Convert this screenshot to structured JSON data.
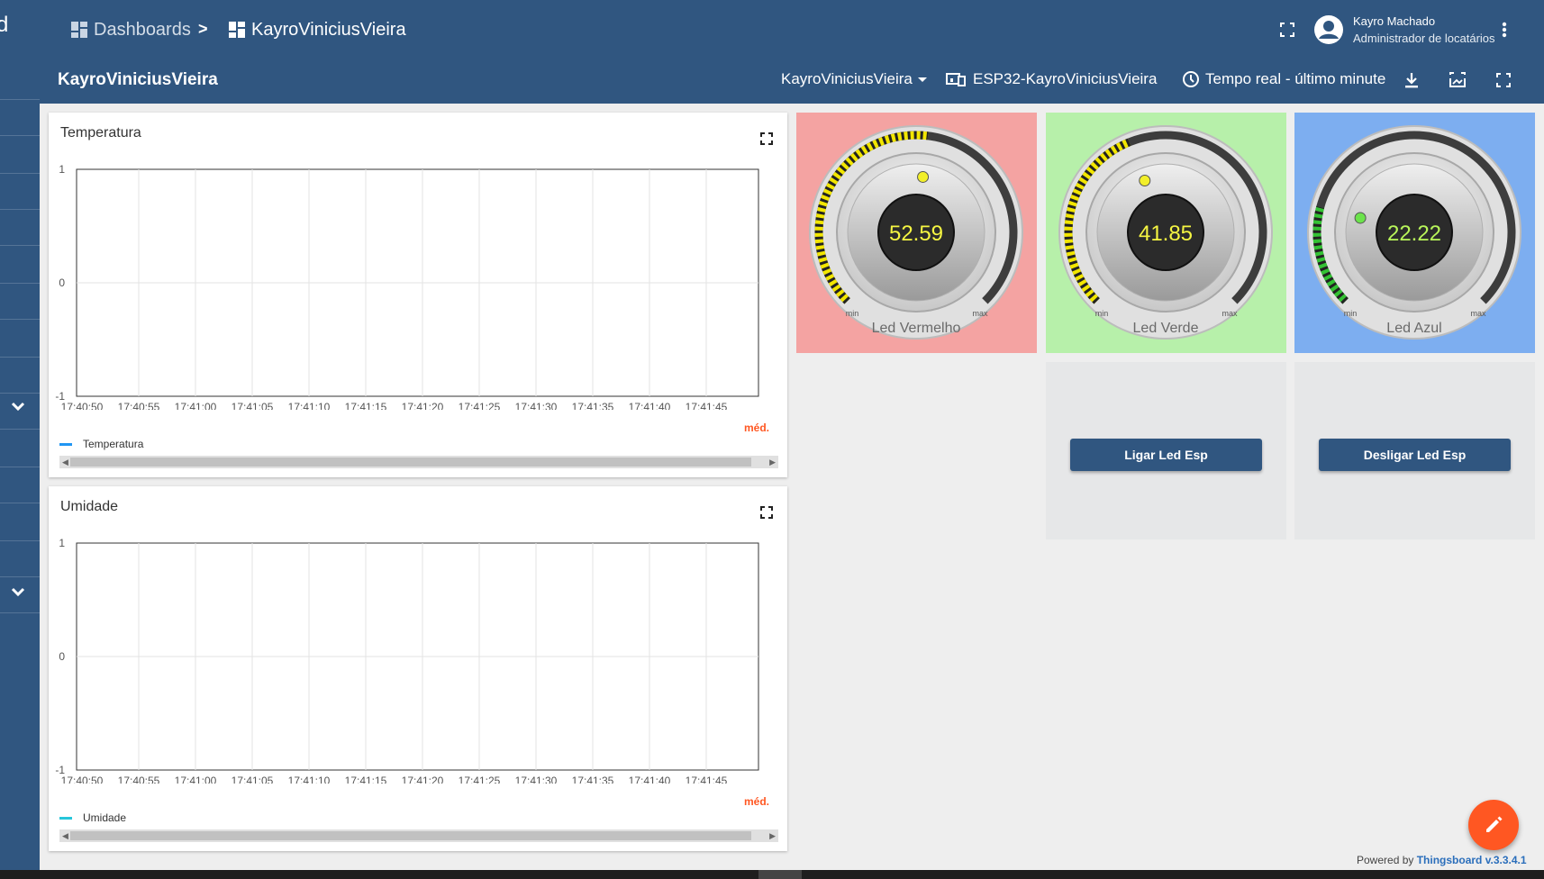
{
  "breadcrumb": {
    "root": "Dashboards",
    "separator": ">",
    "current": "KayroViniciusVieira"
  },
  "user": {
    "name": "Kayro Machado",
    "role": "Administrador de locatários"
  },
  "toolbar": {
    "title": "KayroViniciusVieira",
    "state_select": "KayroViniciusVieira",
    "entity": "ESP32-KayroViniciusVieira",
    "timewindow": "Tempo real - último minute"
  },
  "sidebar": {
    "partial_letter": "d"
  },
  "colors": {
    "primary": "#305680",
    "accent": "#ff5722",
    "knob_red_bg": "#f4a3a2",
    "knob_green_bg": "#b7f0aa",
    "knob_blue_bg": "#7daef0",
    "value_text": "#f5f542"
  },
  "widgets": {
    "temperatura": {
      "title": "Temperatura",
      "legend": "Temperatura",
      "legend_color": "#2196f3",
      "avg_label": "méd."
    },
    "umidade": {
      "title": "Umidade",
      "legend": "Umidade",
      "legend_color": "#26c6da",
      "avg_label": "méd."
    },
    "knobs": [
      {
        "label": "Led Vermelho",
        "value": "52.59",
        "fraction": 0.5259,
        "min_label": "min",
        "max_label": "max",
        "bg": "#f4a3a2",
        "dot": "#f2ef2a"
      },
      {
        "label": "Led Verde",
        "value": "41.85",
        "fraction": 0.4185,
        "min_label": "min",
        "max_label": "max",
        "bg": "#b7f0aa",
        "dot": "#f2ef2a"
      },
      {
        "label": "Led Azul",
        "value": "22.22",
        "fraction": 0.2222,
        "min_label": "min",
        "max_label": "max",
        "bg": "#7daef0",
        "dot": "#6be34b"
      }
    ],
    "buttons": {
      "on": "Ligar Led Esp",
      "off": "Desligar Led Esp"
    }
  },
  "chart_data": [
    {
      "type": "line",
      "title": "Temperatura",
      "series": [
        {
          "name": "Temperatura",
          "values": []
        }
      ],
      "x": [
        "17:40:50",
        "17:40:55",
        "17:41:00",
        "17:41:05",
        "17:41:10",
        "17:41:15",
        "17:41:20",
        "17:41:25",
        "17:41:30",
        "17:41:35",
        "17:41:40",
        "17:41:45"
      ],
      "yticks": [
        "1",
        "0",
        "-1"
      ],
      "ylim": [
        -1,
        1
      ],
      "grid": true,
      "legend": "bottom-left"
    },
    {
      "type": "line",
      "title": "Umidade",
      "series": [
        {
          "name": "Umidade",
          "values": []
        }
      ],
      "x": [
        "17:40:50",
        "17:40:55",
        "17:41:00",
        "17:41:05",
        "17:41:10",
        "17:41:15",
        "17:41:20",
        "17:41:25",
        "17:41:30",
        "17:41:35",
        "17:41:40",
        "17:41:45"
      ],
      "yticks": [
        "1",
        "0",
        "-1"
      ],
      "ylim": [
        -1,
        1
      ],
      "grid": true,
      "legend": "bottom-left"
    }
  ],
  "footer": {
    "powered_by": "Powered by",
    "product": "Thingsboard v.3.3.4.1"
  }
}
